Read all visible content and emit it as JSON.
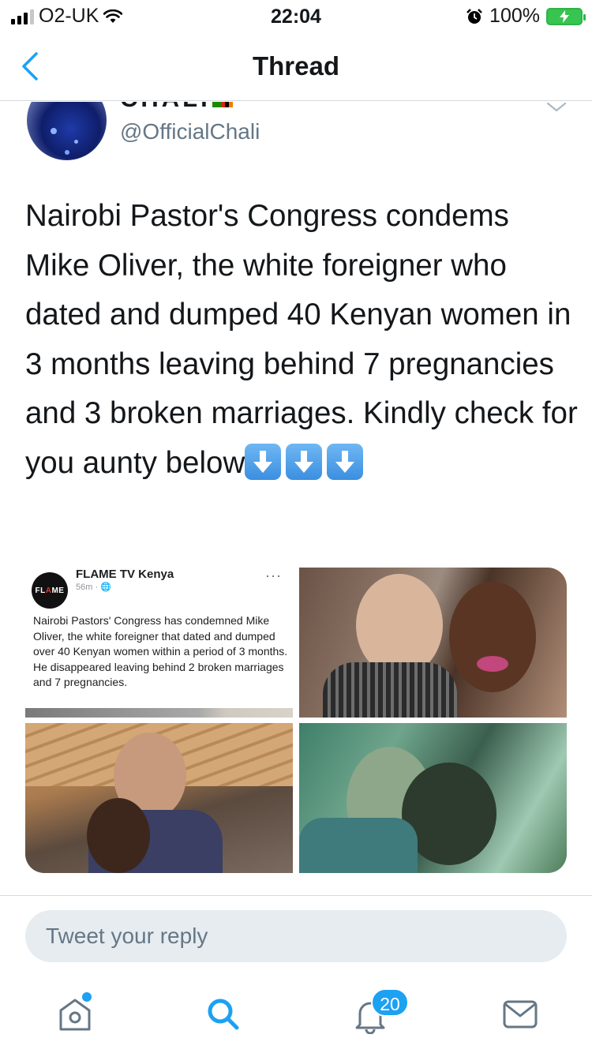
{
  "status_bar": {
    "carrier": "O2-UK",
    "time": "22:04",
    "battery": "100%"
  },
  "nav": {
    "title": "Thread"
  },
  "tweet": {
    "display_name": "CHALI",
    "handle": "@OfficialChali",
    "text": "Nairobi Pastor's Congress condems Mike Oliver, the white foreigner who dated and dumped 40 Kenyan women in 3 months leaving behind 7 pregnancies and 3 broken marriages. Kindly check for you aunty below",
    "emoji": [
      "down-arrow-emoji",
      "down-arrow-emoji",
      "down-arrow-emoji"
    ]
  },
  "media": {
    "post_card": {
      "logo_text_a": "FL",
      "logo_text_b": "A",
      "logo_text_c": "ME",
      "page_name": "FLAME TV Kenya",
      "meta": "56m · 🌐",
      "more": "···",
      "text": "Nairobi Pastors' Congress has condemned Mike Oliver, the white foreigner that dated and dumped over 40 Kenyan women within a period of 3 months. He disappeared leaving behind 2 broken marriages and 7 pregnancies."
    }
  },
  "reply": {
    "placeholder": "Tweet your reply"
  },
  "tabbar": {
    "items": [
      "home-icon",
      "search-icon",
      "notifications-icon",
      "messages-icon"
    ],
    "notification_count": "20"
  },
  "colors": {
    "accent": "#1da1f2",
    "text_primary": "#14171a",
    "text_secondary": "#657786",
    "reply_bg": "#e6ecf0"
  }
}
